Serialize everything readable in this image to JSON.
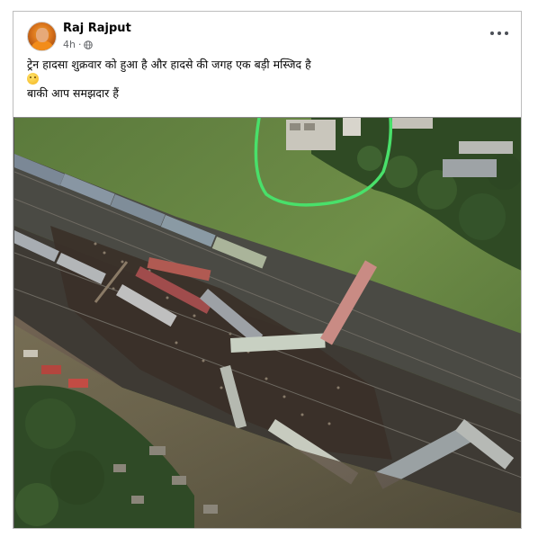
{
  "post": {
    "author": "Raj Rajput",
    "time": "4h",
    "privacy_icon": "globe-icon",
    "menu_icon": "more-horizontal-icon",
    "text_line1": "ट्रेन हादसा शुक्रवार को हुआ है और हादसे की जगह एक बड़ी मस्जिद है",
    "emoji_icon": "thinking-face-icon",
    "text_line3": "बाकी आप समझदार हैं"
  },
  "photo": {
    "subject": "train-accident-aerial-photo",
    "highlight_color": "#49e06a"
  }
}
